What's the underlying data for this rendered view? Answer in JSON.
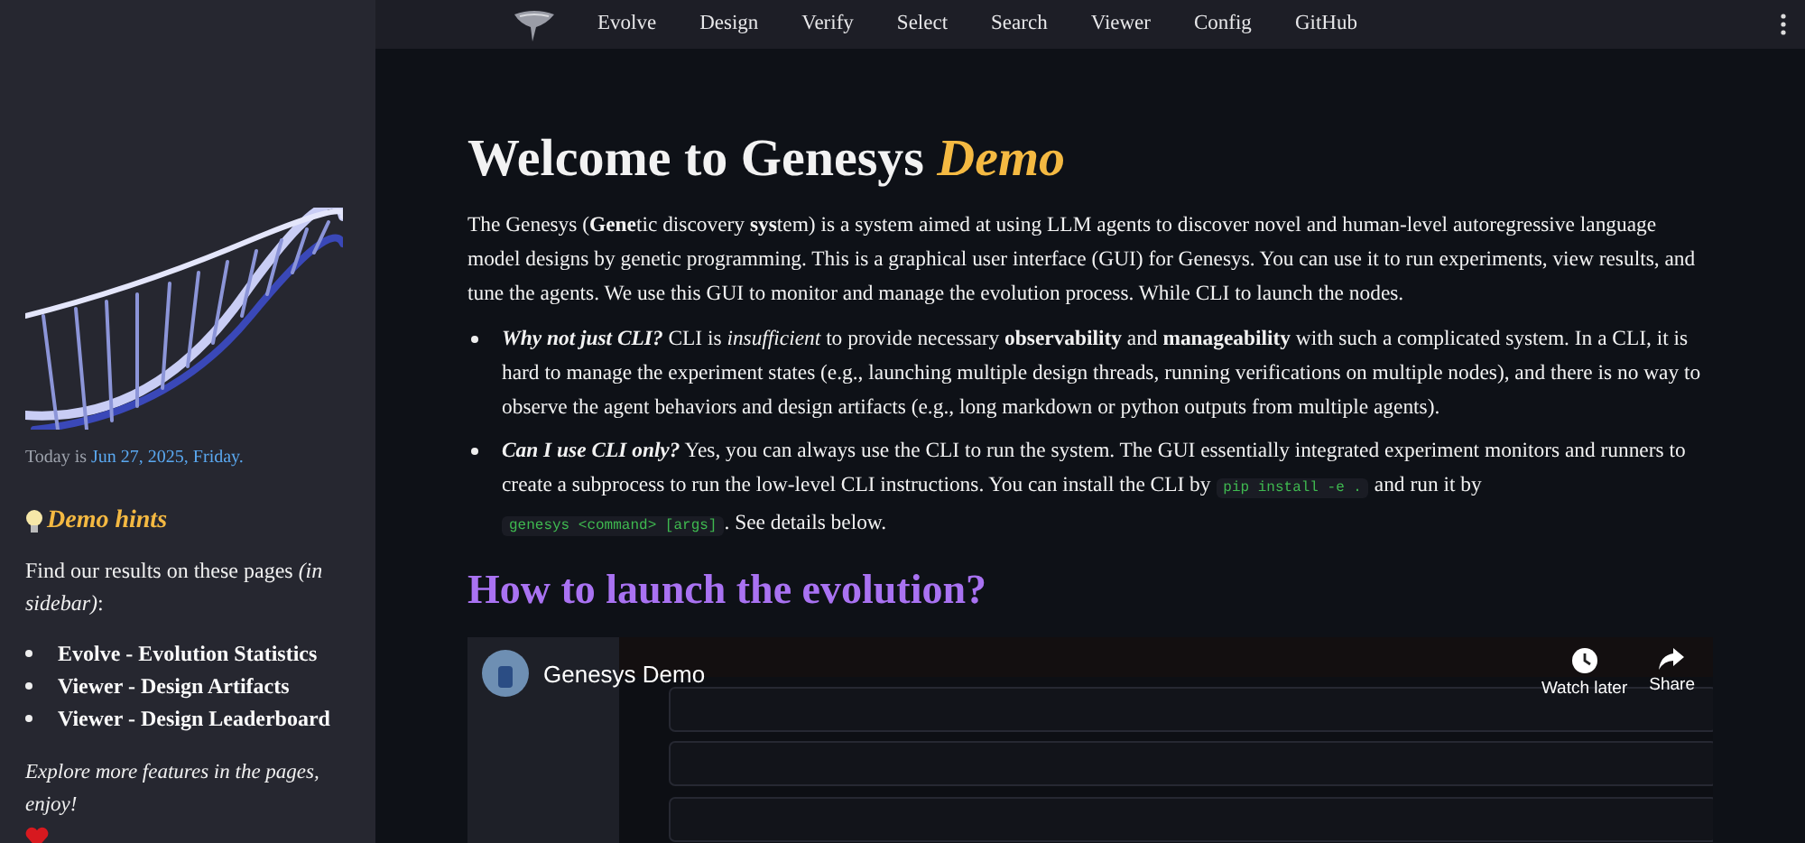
{
  "header": {
    "nav": [
      {
        "label": "Evolve"
      },
      {
        "label": "Design"
      },
      {
        "label": "Verify"
      },
      {
        "label": "Select"
      },
      {
        "label": "Search"
      },
      {
        "label": "Viewer"
      },
      {
        "label": "Config"
      },
      {
        "label": "GitHub"
      }
    ]
  },
  "sidebar": {
    "date_prefix": "Today is",
    "date": "Jun 27, 2025, Friday.",
    "hints_title": "Demo hints",
    "hints_intro": "Find our results on these pages *(in sidebar)*:",
    "hints": [
      "Evolve - Evolution Statistics",
      "Viewer - Design Artifacts",
      "Viewer - Design Leaderboard"
    ],
    "outro": "Explore more features in the pages, enjoy!"
  },
  "main": {
    "title": "Welcome to Genesys",
    "title_accent": "Demo",
    "intro": "The Genesys (**Gene**tic discovery **sys**tem) is a system aimed at using LLM agents to discover novel and human-level autoregressive language model designs by genetic programming. This is a graphical user interface (GUI) for Genesys. You can use it to run experiments, view results, and tune the agents. We use this GUI to monitor and manage the evolution process. While CLI to launch the nodes.",
    "bullets": [
      {
        "lead": "Why not just CLI?",
        "parts": [
          {
            "kind": "text",
            "text": " CLI is *insufficient* to provide necessary **observability** and **manageability** with such a complicated system. In a CLI, it is hard to manage the experiment states (e.g., launching multiple design threads, running verifications on multiple nodes), and there is no way to observe the agent behaviors and design artifacts (e.g., long markdown or python outputs from multiple agents)."
          }
        ]
      },
      {
        "lead": "Can I use CLI only?",
        "parts": [
          {
            "kind": "text",
            "text": " Yes, you can always use the CLI to run the system. The GUI essentially integrated experiment monitors and runners to create a subprocess to run the low-level CLI instructions. You can install the CLI by "
          },
          {
            "kind": "code",
            "text": "pip install -e ."
          },
          {
            "kind": "text",
            "text": " and run it by "
          },
          {
            "kind": "code",
            "text": "genesys <command> [args]"
          },
          {
            "kind": "text",
            "text": ". See details below."
          }
        ]
      }
    ],
    "section_title": "How to launch the evolution?",
    "video": {
      "title": "Genesys Demo",
      "actions": [
        {
          "kind": "clock",
          "label": "Watch later"
        },
        {
          "kind": "share",
          "label": "Share"
        }
      ]
    }
  }
}
